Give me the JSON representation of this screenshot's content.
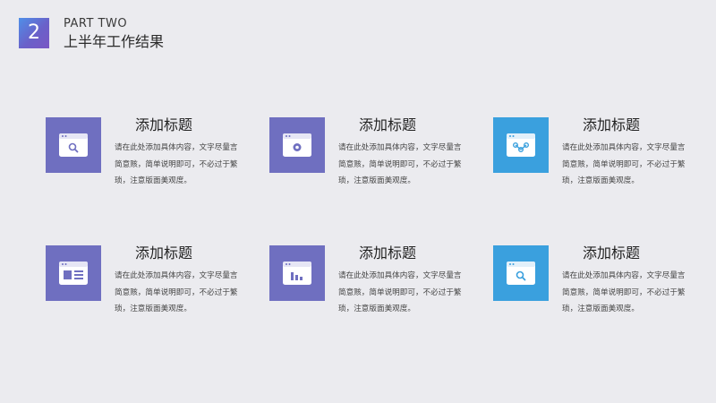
{
  "header": {
    "number": "2",
    "part": "PART TWO",
    "title": "上半年工作结果"
  },
  "colors": {
    "purple": "#6f6fc0",
    "blue": "#3aa0de"
  },
  "cards": [
    {
      "title": "添加标题",
      "desc": "请在此处添加具体内容，文字尽量言简意赅，简单说明即可，不必过于繁琐，注意版面美观度。",
      "icon": "browser-search-icon",
      "color": "purple"
    },
    {
      "title": "添加标题",
      "desc": "请在此处添加具体内容，文字尽量言简意赅，简单说明即可，不必过于繁琐，注意版面美观度。",
      "icon": "browser-settings-icon",
      "color": "purple"
    },
    {
      "title": "添加标题",
      "desc": "请在此处添加具体内容，文字尽量言简意赅，简单说明即可，不必过于繁琐，注意版面美观度。",
      "icon": "browser-network-icon",
      "color": "blue"
    },
    {
      "title": "添加标题",
      "desc": "请在此处添加具体内容，文字尽量言简意赅，简单说明即可，不必过于繁琐，注意版面美观度。",
      "icon": "browser-layout-icon",
      "color": "purple"
    },
    {
      "title": "添加标题",
      "desc": "请在此处添加具体内容，文字尽量言简意赅，简单说明即可，不必过于繁琐，注意版面美观度。",
      "icon": "browser-chart-icon",
      "color": "purple"
    },
    {
      "title": "添加标题",
      "desc": "请在此处添加具体内容，文字尽量言简意赅，简单说明即可，不必过于繁琐，注意版面美观度。",
      "icon": "browser-search-icon",
      "color": "blue"
    }
  ]
}
